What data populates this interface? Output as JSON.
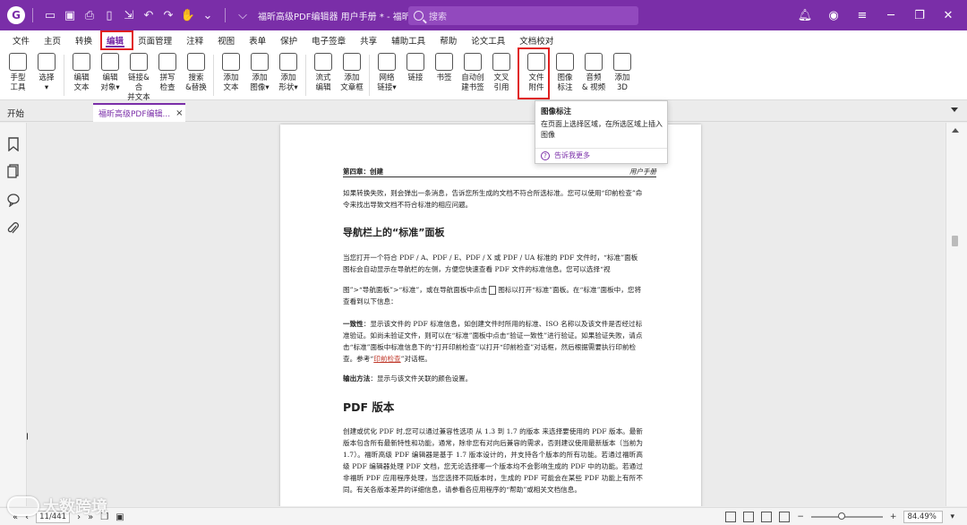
{
  "titlebar": {
    "title": "福昕高级PDF编辑器 用户手册 * - 福昕高级PDF编...",
    "search_placeholder": "搜索",
    "accent": "#7a2ea8"
  },
  "menu": {
    "tabs": [
      "文件",
      "主页",
      "转换",
      "编辑",
      "页面管理",
      "注释",
      "视图",
      "表单",
      "保护",
      "电子签章",
      "共享",
      "辅助工具",
      "帮助",
      "论文工具",
      "文档校对"
    ],
    "active": "编辑"
  },
  "ribbon": {
    "items": [
      {
        "label": "手型\n工具",
        "icon": "hand-icon"
      },
      {
        "label": "选择\n▾",
        "icon": "select-icon"
      },
      {
        "label": "编辑\n文本",
        "icon": "edit-text-icon"
      },
      {
        "label": "编辑\n对象▾",
        "icon": "edit-object-icon"
      },
      {
        "label": "链接&合\n并文本",
        "icon": "link-merge-text-icon"
      },
      {
        "label": "拼写\n检查",
        "icon": "spell-check-icon"
      },
      {
        "label": "搜索\n&替换",
        "icon": "search-replace-icon"
      },
      {
        "label": "添加\n文本",
        "icon": "add-text-icon"
      },
      {
        "label": "添加\n图像▾",
        "icon": "add-image-icon"
      },
      {
        "label": "添加\n形状▾",
        "icon": "add-shape-icon"
      },
      {
        "label": "流式\n编辑",
        "icon": "flow-edit-icon"
      },
      {
        "label": "添加\n文章框",
        "icon": "article-box-icon"
      },
      {
        "label": "网络\n链接▾",
        "icon": "web-link-icon"
      },
      {
        "label": "链接",
        "icon": "link-icon"
      },
      {
        "label": "书签",
        "icon": "bookmark-icon"
      },
      {
        "label": "自动创\n建书签",
        "icon": "auto-bookmark-icon"
      },
      {
        "label": "文叉\n引用",
        "icon": "cross-reference-icon"
      },
      {
        "label": "文件\n附件",
        "icon": "file-attachment-icon"
      },
      {
        "label": "图像\n标注",
        "icon": "image-annotation-icon"
      },
      {
        "label": "音频\n& 视频",
        "icon": "audio-video-icon"
      },
      {
        "label": "添加\n3D",
        "icon": "add-3d-icon"
      }
    ]
  },
  "doc_tabs": {
    "home": "开始",
    "document": "福昕高级PDF编辑...",
    "close": "×"
  },
  "tooltip": {
    "title": "图像标注",
    "description": "在页面上选择区域，在所选区域上插入图像",
    "more": "告诉我更多",
    "help_glyph": "?"
  },
  "page": {
    "header_left": "第四章：创建",
    "header_right": "用户手册",
    "para1": "如果转换失败，则会弹出一条消息，告诉您所生成的文档不符合所选标准。您可以使用“印前检查”命令来找出导致文档不符合标准的相应问题。",
    "heading1": "导航栏上的“标准”面板",
    "para2": "当您打开一个符合 PDF / A、PDF / E、PDF / X 或 PDF / UA 标准的 PDF 文件时，“标准”面板图标会自动显示在导航栏的左侧，方便您快速查看 PDF 文件的标准信息。您可以选择“视",
    "para3a": "图”>“导航面板”>“标准”，或在导航面板中点击",
    "para3b": "图标以打开“标准”面板。在“标准”面板中，您将查看到以下信息：",
    "para4_bold": "一致性",
    "para4_a": "：显示该文件的 PDF 标准信息，如创建文件时所用的标准、ISO 名称以及该文件是否经过标准验证。如尚未验证文件，则可以在“标准”面板中点击“验证一致性”进行验证。如果验证失败，请点击“标准”面板中标准信息下的“打开印前检查”以打开“印前检查”对话框，然后根据需要执行印前检查。参考“",
    "para4_link": "印前检查",
    "para4_b": "”对话框。",
    "para5_bold": "输出方法",
    "para5": "：显示与该文件关联的颜色设置。",
    "heading2": "PDF 版本",
    "para6": "创建或优化 PDF 时,您可以通过兼容性选项 从 1.3 到 1.7 的版本 来选择要使用的 PDF 版本。最新版本包含所有最新特性和功能，通常，除非您有对向后兼容的需求，否则建议使用最新版本（当前为 1.7）。福昕高级 PDF 编辑器是基于 1.7 版本设计的，并支持各个版本的所有功能。若通过福昕高级 PDF 编辑器处理 PDF 文档，您无论选择哪一个版本均不会影响生成的 PDF 中的功能。若通过非福昕 PDF 应用程序处理，当您选择不同版本时，生成的 PDF 可能会在某些 PDF 功能上有所不同。有关各版本差异的详细信息，请参看各应用程序的“帮助”或相关文档信息。"
  },
  "statusbar": {
    "page_value": "11/441",
    "zoom_value": "84.49%",
    "zoom_fraction": 0.42
  },
  "watermark": {
    "text": "大数跨境"
  }
}
